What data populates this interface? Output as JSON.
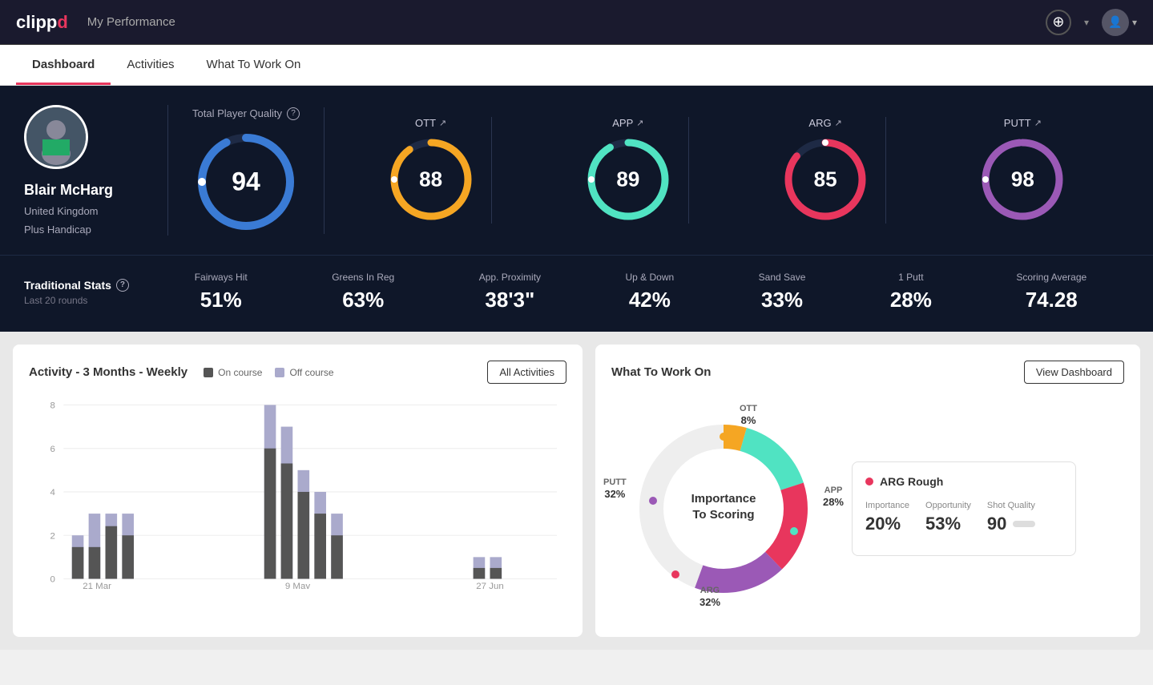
{
  "header": {
    "logo": "clippd",
    "logo_clip": "clipp",
    "logo_d": "d",
    "title": "My Performance",
    "add_btn": "+",
    "chevron": "▾"
  },
  "nav": {
    "tabs": [
      {
        "label": "Dashboard",
        "active": true
      },
      {
        "label": "Activities",
        "active": false
      },
      {
        "label": "What To Work On",
        "active": false
      }
    ]
  },
  "player": {
    "name": "Blair McHarg",
    "country": "United Kingdom",
    "handicap": "Plus Handicap"
  },
  "total_quality": {
    "label": "Total Player Quality",
    "value": "94"
  },
  "sub_gauges": [
    {
      "label": "OTT",
      "value": "88",
      "color": "#f5a623"
    },
    {
      "label": "APP",
      "value": "89",
      "color": "#50e3c2"
    },
    {
      "label": "ARG",
      "value": "85",
      "color": "#e8365d"
    },
    {
      "label": "PUTT",
      "value": "98",
      "color": "#9b59b6"
    }
  ],
  "trad_stats": {
    "title": "Traditional Stats",
    "period": "Last 20 rounds",
    "items": [
      {
        "name": "Fairways Hit",
        "value": "51%"
      },
      {
        "name": "Greens In Reg",
        "value": "63%"
      },
      {
        "name": "App. Proximity",
        "value": "38'3\""
      },
      {
        "name": "Up & Down",
        "value": "42%"
      },
      {
        "name": "Sand Save",
        "value": "33%"
      },
      {
        "name": "1 Putt",
        "value": "28%"
      },
      {
        "name": "Scoring Average",
        "value": "74.28"
      }
    ]
  },
  "activity_chart": {
    "title": "Activity - 3 Months - Weekly",
    "legend": [
      {
        "label": "On course",
        "color": "#555"
      },
      {
        "label": "Off course",
        "color": "#aac"
      }
    ],
    "all_activities_btn": "All Activities",
    "x_labels": [
      "21 Mar",
      "9 May",
      "27 Jun"
    ],
    "y_labels": [
      "0",
      "2",
      "4",
      "6",
      "8"
    ]
  },
  "what_to_work_on": {
    "title": "What To Work On",
    "view_dashboard_btn": "View Dashboard",
    "donut_center": "Importance\nTo Scoring",
    "segments": [
      {
        "label": "OTT\n8%",
        "color": "#f5a623",
        "pct": 8
      },
      {
        "label": "APP\n28%",
        "color": "#50e3c2",
        "pct": 28
      },
      {
        "label": "ARG\n32%",
        "color": "#e8365d",
        "pct": 32
      },
      {
        "label": "PUTT\n32%",
        "color": "#9b59b6",
        "pct": 32
      }
    ],
    "card": {
      "title": "ARG Rough",
      "metrics": [
        {
          "name": "Importance",
          "value": "20%"
        },
        {
          "name": "Opportunity",
          "value": "53%"
        },
        {
          "name": "Shot Quality",
          "value": "90"
        }
      ]
    }
  }
}
